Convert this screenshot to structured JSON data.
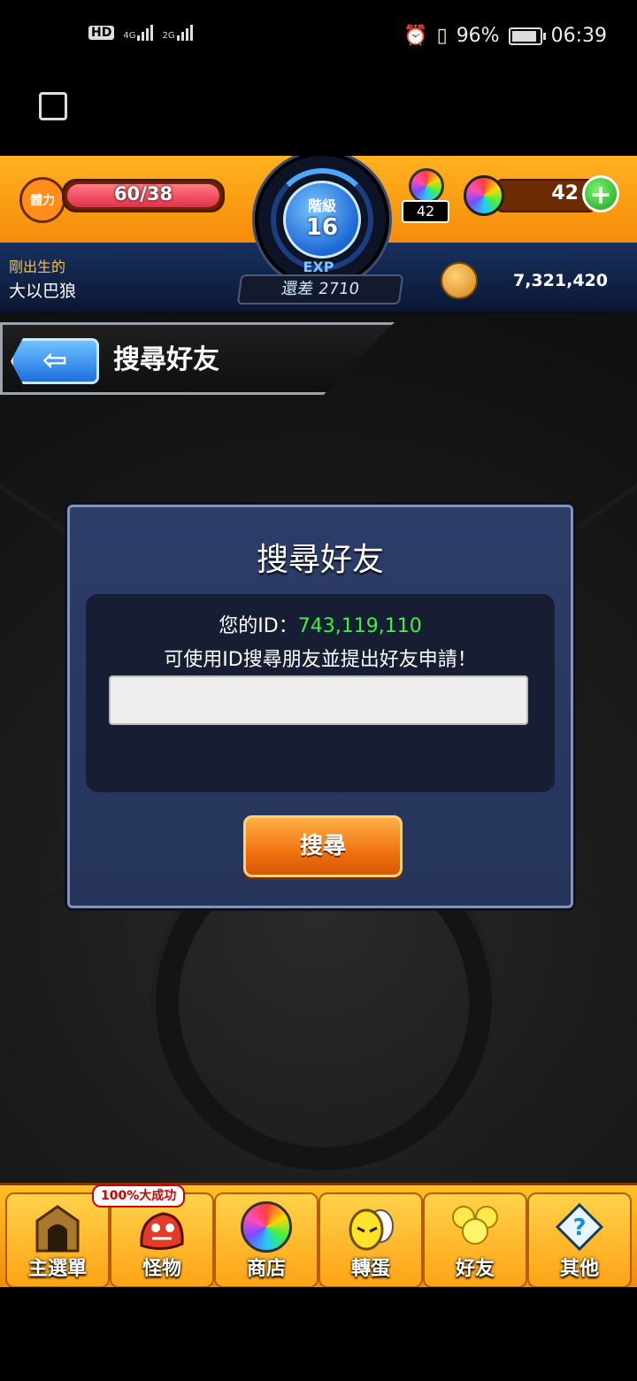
{
  "status_bar": {
    "net_hd": "HD",
    "net_1": "4G",
    "net_2": "2G",
    "battery_pct": "96%",
    "time": "06:39"
  },
  "header": {
    "stamina_label": "體力",
    "stamina_text": "60/38",
    "rank_label": "階級",
    "rank_value": "16",
    "exp_label": "EXP",
    "exp_remaining": "還差 2710",
    "orb_box_count": "42",
    "orb_count": "42",
    "player_title": "剛出生的",
    "player_name": "大以巴狼",
    "gold": "7,321,420"
  },
  "page": {
    "title": "搜尋好友"
  },
  "dialog": {
    "title": "搜尋好友",
    "id_label": "您的ID：",
    "id_value": "743,119,110",
    "help_text": "可使用ID搜尋朋友並提出好友申請！",
    "input_placeholder": "",
    "search_button": "搜尋"
  },
  "tabbar": {
    "badge": "100%大成功",
    "items": [
      {
        "label": "主選單",
        "icon": "gate-icon"
      },
      {
        "label": "怪物",
        "icon": "monster-icon"
      },
      {
        "label": "商店",
        "icon": "orb-icon"
      },
      {
        "label": "轉蛋",
        "icon": "egg-icon"
      },
      {
        "label": "好友",
        "icon": "friends-icon"
      },
      {
        "label": "其他",
        "icon": "question-icon"
      }
    ]
  },
  "colors": {
    "accent_orange": "#f58a0a",
    "dialog_blue": "#2d3d69",
    "id_green": "#3df23d"
  }
}
